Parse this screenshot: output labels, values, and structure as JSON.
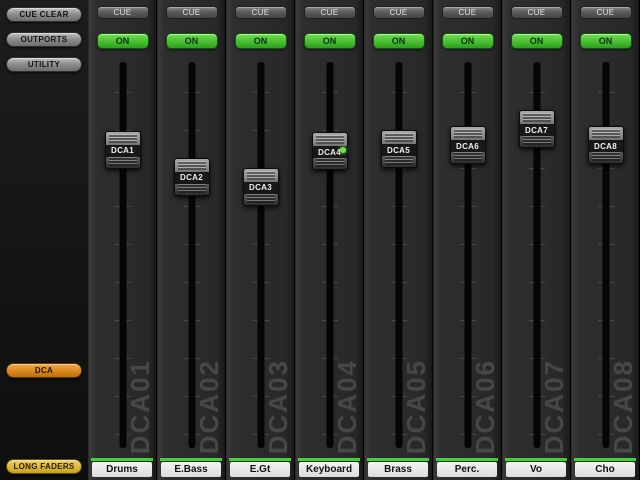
{
  "sidebar": {
    "cue_clear_label": "CUE CLEAR",
    "outports_label": "OUTPORTS",
    "utility_label": "UTILITY",
    "dca_label": "DCA",
    "long_faders_label": "LONG FADERS"
  },
  "colors": {
    "on_green_hi": "#6fe24e",
    "on_green_lo": "#2da01c",
    "accent_orange_hi": "#f4a93c",
    "accent_orange_lo": "#c06f08",
    "accent_yellow_hi": "#f2d25c",
    "accent_yellow_lo": "#c9a21a",
    "channel_color_bar": "#3fd435"
  },
  "channels": [
    {
      "bg_label": "DCA01",
      "knob_label": "DCA1",
      "name": "Drums",
      "cue_label": "CUE",
      "on_label": "ON",
      "knob_top_pct": 18.8,
      "touch_indicator": false
    },
    {
      "bg_label": "DCA02",
      "knob_label": "DCA2",
      "name": "E.Bass",
      "cue_label": "CUE",
      "on_label": "ON",
      "knob_top_pct": 25.6,
      "touch_indicator": false
    },
    {
      "bg_label": "DCA03",
      "knob_label": "DCA3",
      "name": "E.Gt",
      "cue_label": "CUE",
      "on_label": "ON",
      "knob_top_pct": 28.1,
      "touch_indicator": false
    },
    {
      "bg_label": "DCA04",
      "knob_label": "DCA4",
      "name": "Keyboard",
      "cue_label": "CUE",
      "on_label": "ON",
      "knob_top_pct": 19.1,
      "touch_indicator": true
    },
    {
      "bg_label": "DCA05",
      "knob_label": "DCA5",
      "name": "Brass",
      "cue_label": "CUE",
      "on_label": "ON",
      "knob_top_pct": 18.6,
      "touch_indicator": false
    },
    {
      "bg_label": "DCA06",
      "knob_label": "DCA6",
      "name": "Perc.",
      "cue_label": "CUE",
      "on_label": "ON",
      "knob_top_pct": 17.6,
      "touch_indicator": false
    },
    {
      "bg_label": "DCA07",
      "knob_label": "DCA7",
      "name": "Vo",
      "cue_label": "CUE",
      "on_label": "ON",
      "knob_top_pct": 13.6,
      "touch_indicator": false
    },
    {
      "bg_label": "DCA08",
      "knob_label": "DCA8",
      "name": "Cho",
      "cue_label": "CUE",
      "on_label": "ON",
      "knob_top_pct": 17.6,
      "touch_indicator": false
    }
  ]
}
